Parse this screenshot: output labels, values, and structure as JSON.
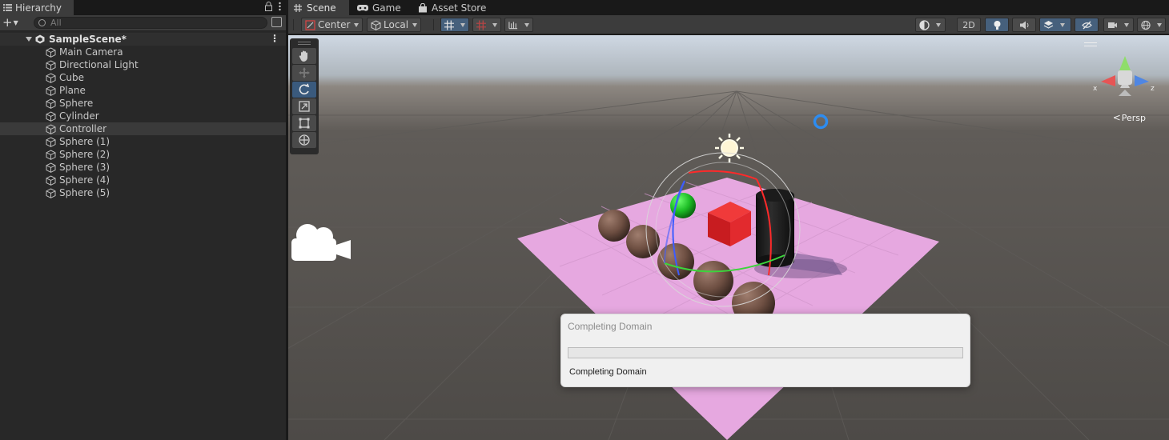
{
  "hierarchy": {
    "tab_label": "Hierarchy",
    "search_placeholder": "All",
    "scene_name": "SampleScene*",
    "items": [
      {
        "label": "Main Camera"
      },
      {
        "label": "Directional Light"
      },
      {
        "label": "Cube"
      },
      {
        "label": "Plane"
      },
      {
        "label": "Sphere"
      },
      {
        "label": "Cylinder"
      },
      {
        "label": "Controller"
      },
      {
        "label": "Sphere (1)"
      },
      {
        "label": "Sphere (2)"
      },
      {
        "label": "Sphere (3)"
      },
      {
        "label": "Sphere (4)"
      },
      {
        "label": "Sphere (5)"
      }
    ],
    "selected_item": "Controller"
  },
  "tabs": [
    {
      "label": "Scene",
      "icon": "grid-icon",
      "active": true
    },
    {
      "label": "Game",
      "icon": "gamepad-icon",
      "active": false
    },
    {
      "label": "Asset Store",
      "icon": "shopping-bag-icon",
      "active": false
    }
  ],
  "scene_toolbar": {
    "pivot_label": "Center",
    "space_label": "Local",
    "mode_2d_label": "2D"
  },
  "viewport": {
    "projection_label": "Persp",
    "axis_labels": {
      "x": "x",
      "z": "z"
    },
    "active_tool": "rotate"
  },
  "progress_dialog": {
    "title": "Completing Domain",
    "info": "Completing Domain",
    "progress": 0
  },
  "colors": {
    "accent_blue": "#3a5a7d",
    "plane_pink": "#e6a8e0",
    "cube_red": "#e3262a",
    "sphere_green": "#22c52c",
    "sphere_brown": "#7a5a4b"
  }
}
